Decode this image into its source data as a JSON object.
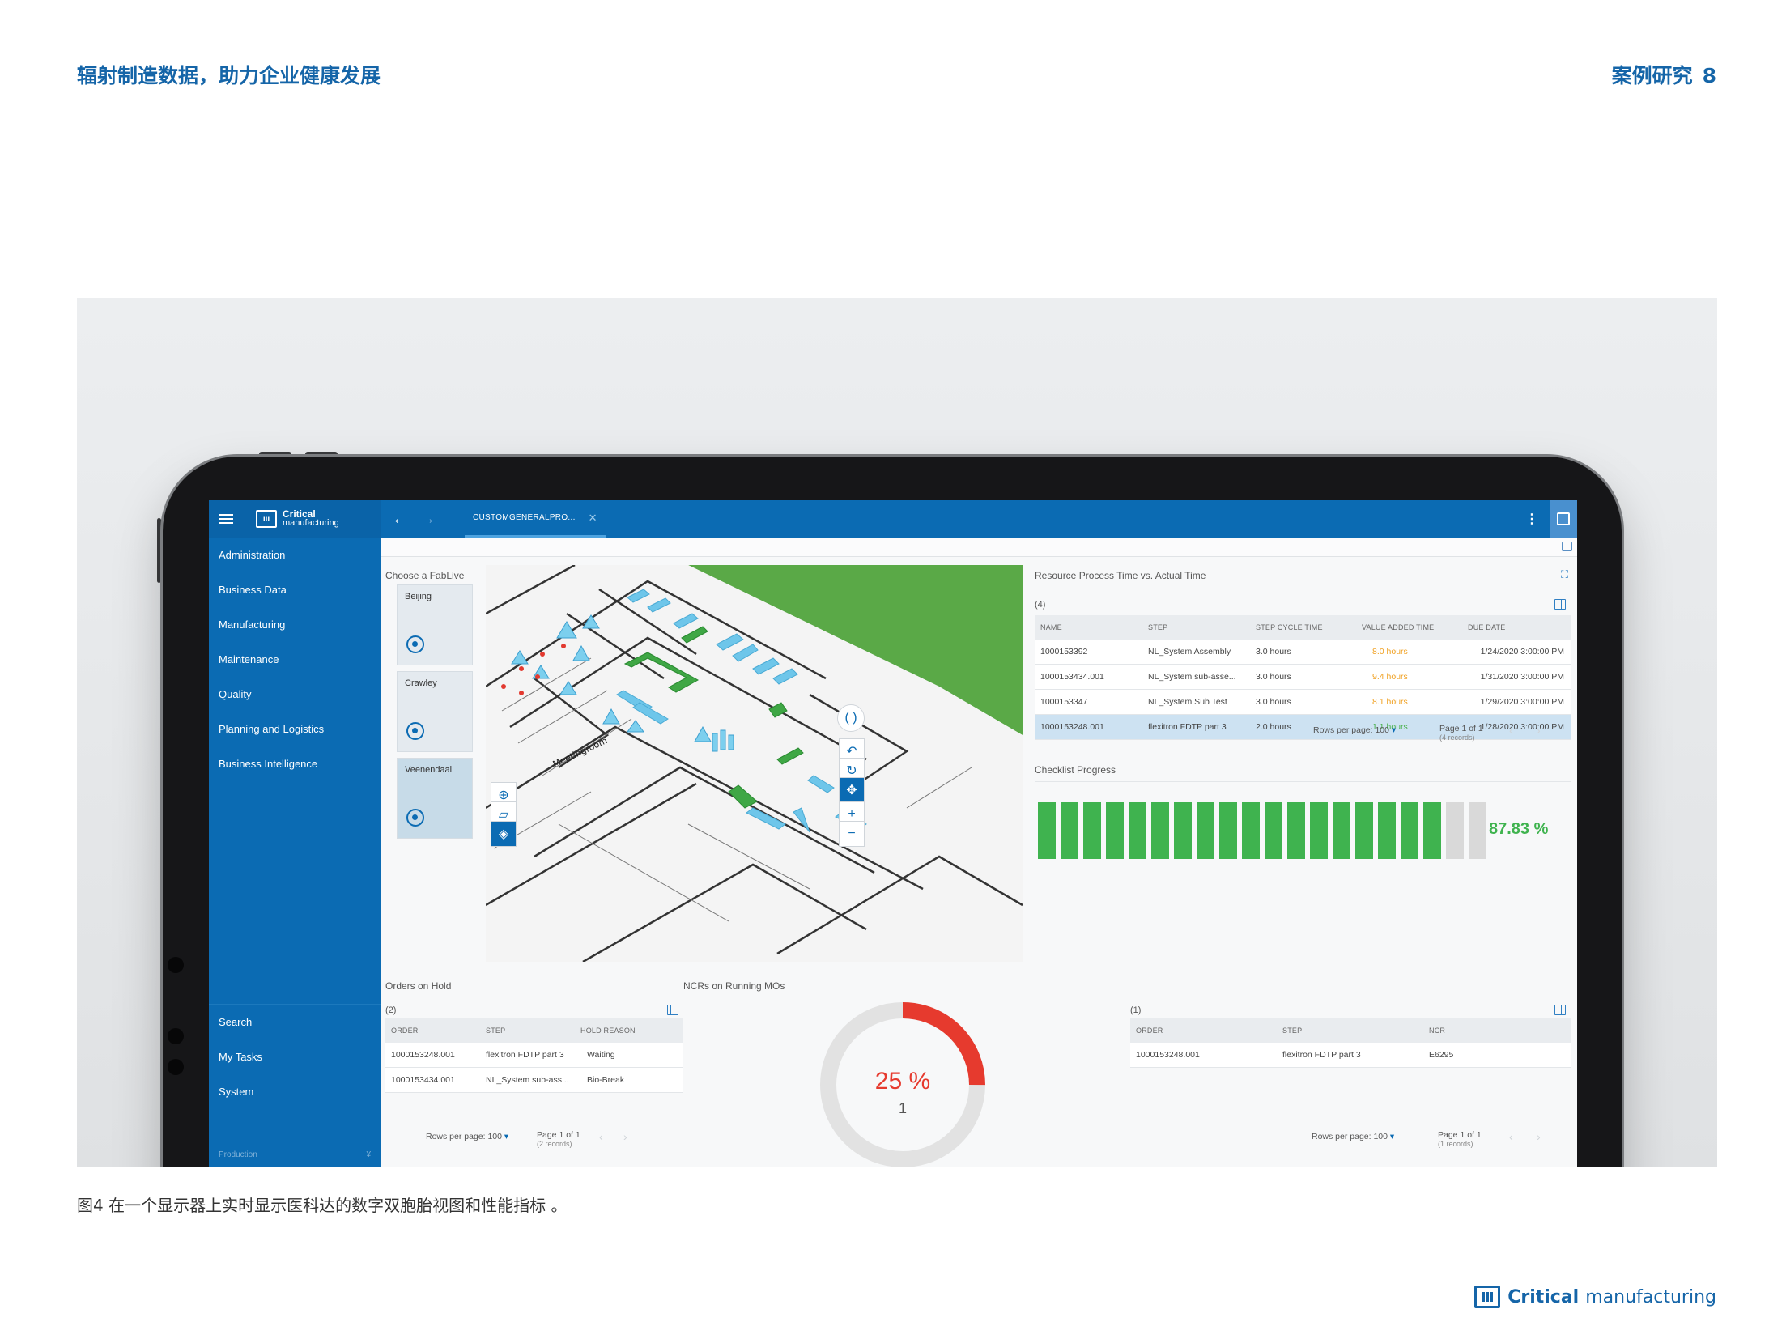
{
  "page_header": {
    "title": "辐射制造数据，助力企业健康发展",
    "section": "案例研究",
    "page_number": "8"
  },
  "app": {
    "brand_line1": "Critical",
    "brand_line2": "manufacturing",
    "tab_label": "CUSTOMGENERALPRO...",
    "tab_close": "✕",
    "more_menu": "⋮",
    "nav_back": "←",
    "nav_forward": "→",
    "sidebar_items": [
      "Administration",
      "Business Data",
      "Manufacturing",
      "Maintenance",
      "Quality",
      "Planning and Logistics",
      "Business Intelligence"
    ],
    "sidebar_bottom_items": [
      "Search",
      "My Tasks",
      "System"
    ],
    "sidebar_footer": "Production"
  },
  "fablive": {
    "title": "Choose a FabLive",
    "sites": [
      "Beijing",
      "Crawley",
      "Veenendaal"
    ],
    "map_labels": [
      "Meetingroom"
    ]
  },
  "resource_table": {
    "title": "Resource Process Time vs. Actual Time",
    "count": "(4)",
    "columns": [
      "NAME",
      "STEP",
      "STEP CYCLE TIME",
      "VALUE ADDED TIME",
      "DUE DATE"
    ],
    "rows": [
      [
        "1000153392",
        "NL_System Assembly",
        "3.0 hours",
        "8.0 hours",
        "1/24/2020 3:00:00 PM"
      ],
      [
        "1000153434.001",
        "NL_System sub-asse...",
        "3.0 hours",
        "9.4 hours",
        "1/31/2020 3:00:00 PM"
      ],
      [
        "1000153347",
        "NL_System Sub Test",
        "3.0 hours",
        "8.1 hours",
        "1/29/2020 3:00:00 PM"
      ],
      [
        "1000153248.001",
        "flexitron FDTP part 3",
        "2.0 hours",
        "1.1 hours",
        "1/28/2020 3:00:00 PM"
      ]
    ],
    "rows_per_page_label": "Rows per page: 100",
    "page_label": "Page 1 of 1",
    "records_label": "(4 records)"
  },
  "checklist": {
    "title": "Checklist Progress",
    "percent": 87.83,
    "percent_label": "87.83 %",
    "segments_total": 20,
    "segments_done": 18
  },
  "orders_on_hold": {
    "title": "Orders on Hold",
    "count": "(2)",
    "columns": [
      "ORDER",
      "STEP",
      "HOLD REASON"
    ],
    "rows": [
      [
        "1000153248.001",
        "flexitron FDTP part 3",
        "Waiting"
      ],
      [
        "1000153434.001",
        "NL_System sub-ass...",
        "Bio-Break"
      ]
    ],
    "rows_per_page_label": "Rows per page: 100",
    "page_label": "Page 1 of 1",
    "records_label": "(2 records)"
  },
  "ncrs": {
    "title": "NCRs on Running MOs",
    "gauge_percent": 25,
    "gauge_label": "25 %",
    "gauge_count": "1",
    "count": "(1)",
    "columns": [
      "ORDER",
      "STEP",
      "NCR"
    ],
    "rows": [
      [
        "1000153248.001",
        "flexitron FDTP part 3",
        "E6295"
      ]
    ],
    "rows_per_page_label": "Rows per page: 100",
    "page_label": "Page 1 of 1",
    "records_label": "(1 records)"
  },
  "caption": {
    "figure": "图4",
    "text": "在一个显示器上实时显示医科达的数字双胞胎视图和性能指标 。"
  },
  "footer_logo": {
    "bold": "Critical",
    "light": "manufacturing"
  },
  "colors": {
    "brand_blue": "#1565a8",
    "app_blue": "#0b6bb3",
    "progress_green": "#3fb34f",
    "gauge_red": "#e63a2e",
    "value_orange": "#f0a020"
  }
}
